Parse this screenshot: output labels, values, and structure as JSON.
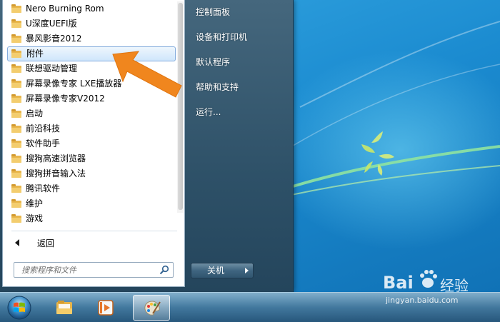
{
  "start_menu": {
    "programs": [
      {
        "label": "Nero Burning Rom",
        "selected": false
      },
      {
        "label": "U深度UEFI版",
        "selected": false
      },
      {
        "label": "暴风影音2012",
        "selected": false
      },
      {
        "label": "附件",
        "selected": true
      },
      {
        "label": "联想驱动管理",
        "selected": false
      },
      {
        "label": "屏幕录像专家 LXE播放器",
        "selected": false
      },
      {
        "label": "屏幕录像专家V2012",
        "selected": false
      },
      {
        "label": "启动",
        "selected": false
      },
      {
        "label": "前沿科技",
        "selected": false
      },
      {
        "label": "软件助手",
        "selected": false
      },
      {
        "label": "搜狗高速浏览器",
        "selected": false
      },
      {
        "label": "搜狗拼音输入法",
        "selected": false
      },
      {
        "label": "腾讯软件",
        "selected": false
      },
      {
        "label": "维护",
        "selected": false
      },
      {
        "label": "游戏",
        "selected": false
      }
    ],
    "back_label": "返回",
    "search": {
      "placeholder": "搜索程序和文件"
    },
    "right_items": [
      {
        "label": "控制面板"
      },
      {
        "label": "设备和打印机"
      },
      {
        "label": "默认程序"
      },
      {
        "label": "帮助和支持"
      },
      {
        "label": "运行..."
      }
    ],
    "shutdown_label": "关机"
  },
  "taskbar": {
    "buttons": [
      {
        "name": "windows-explorer",
        "icon": "folder-icon",
        "active": false
      },
      {
        "name": "media-player",
        "icon": "media-player-icon",
        "active": false
      },
      {
        "name": "paint",
        "icon": "paint-palette-icon",
        "active": true
      }
    ]
  },
  "watermark": {
    "brand_left": "Bai",
    "brand_right": "经验",
    "url": "jingyan.baidu.com"
  },
  "colors": {
    "accent_arrow": "#f0861e",
    "menu_dark": "#2e5168",
    "selection_border": "#84acdd",
    "folder": "#e8b64c"
  }
}
